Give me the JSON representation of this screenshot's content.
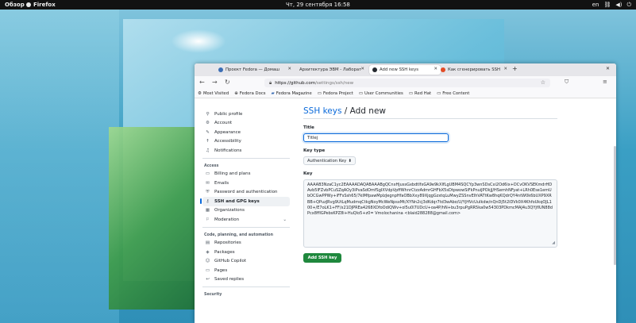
{
  "topbar": {
    "overview": "Обзор",
    "app_name": "Firefox",
    "clock": "Чт, 29 сентября 16:58",
    "lang": "en",
    "network_icon": "network-icon",
    "sound_icon": "speaker-icon",
    "power_icon": "power-icon"
  },
  "tabs": [
    {
      "label": "Проект Fedora — Домаш",
      "color": "#3c6eb4"
    },
    {
      "label": "Архитектура ЭВМ - Лаборат",
      "color": "#ffffff"
    },
    {
      "label": "Add new SSH keys",
      "color": "#24292f"
    },
    {
      "label": "Как сгенерировать SSH",
      "color": "#e34c26"
    }
  ],
  "navbar": {
    "url_host": "https://github.com",
    "url_path": "/settings/ssh/new"
  },
  "bookmarks": [
    "Most Visited",
    "Fedora Docs",
    "Fedora Magazine",
    "Fedora Project",
    "User Communities",
    "Red Hat",
    "Free Content"
  ],
  "sidebar": {
    "items_top": [
      {
        "label": "Public profile",
        "icon": "person-icon",
        "glyph": "⚲"
      },
      {
        "label": "Account",
        "icon": "gear-icon",
        "glyph": "⚙"
      },
      {
        "label": "Appearance",
        "icon": "paintbrush-icon",
        "glyph": "✎"
      },
      {
        "label": "Accessibility",
        "icon": "accessibility-icon",
        "glyph": "☨"
      },
      {
        "label": "Notifications",
        "icon": "bell-icon",
        "glyph": "♫"
      }
    ],
    "section_access": "Access",
    "items_access": [
      {
        "label": "Billing and plans",
        "icon": "credit-card-icon",
        "glyph": "▭"
      },
      {
        "label": "Emails",
        "icon": "mail-icon",
        "glyph": "✉"
      },
      {
        "label": "Password and authentication",
        "icon": "shield-lock-icon",
        "glyph": "⛨"
      },
      {
        "label": "SSH and GPG keys",
        "icon": "key-icon",
        "glyph": "⚷"
      },
      {
        "label": "Organizations",
        "icon": "organization-icon",
        "glyph": "▦"
      },
      {
        "label": "Moderation",
        "icon": "report-icon",
        "glyph": "⚐"
      }
    ],
    "section_code": "Code, planning, and automation",
    "items_code": [
      {
        "label": "Repositories",
        "icon": "repo-icon",
        "glyph": "▤"
      },
      {
        "label": "Packages",
        "icon": "package-icon",
        "glyph": "◈"
      },
      {
        "label": "GitHub Copilot",
        "icon": "copilot-icon",
        "glyph": "☺"
      },
      {
        "label": "Pages",
        "icon": "browser-icon",
        "glyph": "▭"
      },
      {
        "label": "Saved replies",
        "icon": "reply-icon",
        "glyph": "↩"
      }
    ],
    "section_security": "Security"
  },
  "main": {
    "crumb": "SSH keys",
    "heading_rest": " / Add new",
    "title_label": "Title",
    "title_value": "Titlej",
    "key_type_label": "Key type",
    "key_type_value": "Authentication Key",
    "key_label": "Key",
    "key_value": "AAAAB3NzaC1yc2EAAAADAQABAAABgQCnxHjussGxbdtIfxGA9e9kXIfLgUBM4SQCYp3wnSDsCxi2Od6ix+DCvOKVSEKmdrHDAvb5IFZvbPCuSZqAOy3iPvaSdOmfSgIXVdpVpffWhnrCtzzAdmrGHFbX5sDtpwowSiFkPnuiJPOkjJ/HSemhNFyat+LRh0Ese1emUbOCGwPPWy+iFFsSsh65/7kIMfpawMplzJegnpHfaOBbXxy89XjqgGzxtqLuMwyZSSnvEIhVATtKw8hqKQdrQY4ntW0k6bUXP9XRBB+QPuzJRvg9UtLqMudmqCtkgNoyMcWeNpsxMt/XYNn2cj3dKdqr7td3wAbo/U/YjHVcUuIkdw/nQnDj5t2iDVk0X4KhfoUkqOJL100+/E7oLK1+FF/x21DJPREa4268XDfoOdiQWv+ol5u0l7UDcU+oa4P/hN+bu3rpuPgRR5ka0w54303PDkmcMAJ4u3QYjfIUN88dPcx8ffIGPebsKPZ8i+HuQlo5+z0= Vmolochanina <blaid288288@gmail.com>",
    "add_button": "Add SSH key"
  }
}
